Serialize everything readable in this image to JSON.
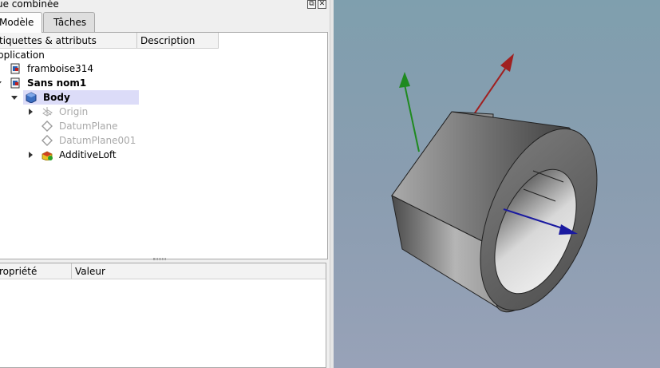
{
  "combo": {
    "title": "ue combinée",
    "tabs": [
      {
        "label": "Modèle",
        "active": true
      },
      {
        "label": "Tâches",
        "active": false
      }
    ],
    "tree": {
      "headers": [
        "tiquettes & attributs",
        "Description"
      ],
      "items": [
        {
          "label": "pplication"
        },
        {
          "label": "framboise314",
          "icon": "document-icon"
        },
        {
          "label": "Sans nom1",
          "icon": "document-icon"
        },
        {
          "label": "Body",
          "icon": "body-icon"
        },
        {
          "label": "Origin",
          "icon": "origin-icon"
        },
        {
          "label": "DatumPlane",
          "icon": "datum-plane-icon"
        },
        {
          "label": "DatumPlane001",
          "icon": "datum-plane-icon"
        },
        {
          "label": "AdditiveLoft",
          "icon": "additive-loft-icon"
        }
      ]
    },
    "properties": {
      "headers": [
        "ropriété",
        "Valeur"
      ]
    }
  },
  "colors": {
    "selection": "#dcdcf8",
    "axis_x": "#1a1aa0",
    "axis_y": "#1f8a1f",
    "axis_z": "#a02020",
    "view_bg_top": "#7f9fae",
    "view_bg_bottom": "#98a2b8"
  }
}
